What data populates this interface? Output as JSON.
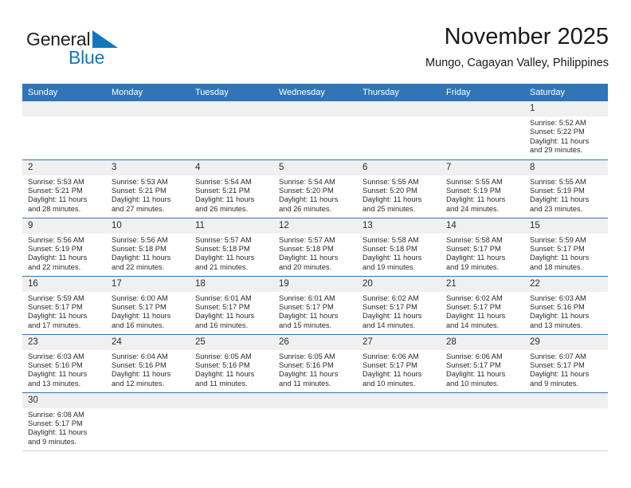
{
  "logo": {
    "word_one": "General",
    "word_two": "Blue",
    "flag_icon": "triangle-flag-icon",
    "blue": "#1278be"
  },
  "header": {
    "month_title": "November 2025",
    "location": "Mungo, Cagayan Valley, Philippines"
  },
  "colors": {
    "header_blue": "#3175b7",
    "daynum_gray": "#f0f0f0",
    "text": "#2b2b2b"
  },
  "weekday_headers": [
    "Sunday",
    "Monday",
    "Tuesday",
    "Wednesday",
    "Thursday",
    "Friday",
    "Saturday"
  ],
  "weeks": [
    [
      {
        "day": "",
        "sunrise": "",
        "sunset": "",
        "daylight_1": "",
        "daylight_2": ""
      },
      {
        "day": "",
        "sunrise": "",
        "sunset": "",
        "daylight_1": "",
        "daylight_2": ""
      },
      {
        "day": "",
        "sunrise": "",
        "sunset": "",
        "daylight_1": "",
        "daylight_2": ""
      },
      {
        "day": "",
        "sunrise": "",
        "sunset": "",
        "daylight_1": "",
        "daylight_2": ""
      },
      {
        "day": "",
        "sunrise": "",
        "sunset": "",
        "daylight_1": "",
        "daylight_2": ""
      },
      {
        "day": "",
        "sunrise": "",
        "sunset": "",
        "daylight_1": "",
        "daylight_2": ""
      },
      {
        "day": "1",
        "sunrise": "Sunrise: 5:52 AM",
        "sunset": "Sunset: 5:22 PM",
        "daylight_1": "Daylight: 11 hours",
        "daylight_2": "and 29 minutes."
      }
    ],
    [
      {
        "day": "2",
        "sunrise": "Sunrise: 5:53 AM",
        "sunset": "Sunset: 5:21 PM",
        "daylight_1": "Daylight: 11 hours",
        "daylight_2": "and 28 minutes."
      },
      {
        "day": "3",
        "sunrise": "Sunrise: 5:53 AM",
        "sunset": "Sunset: 5:21 PM",
        "daylight_1": "Daylight: 11 hours",
        "daylight_2": "and 27 minutes."
      },
      {
        "day": "4",
        "sunrise": "Sunrise: 5:54 AM",
        "sunset": "Sunset: 5:21 PM",
        "daylight_1": "Daylight: 11 hours",
        "daylight_2": "and 26 minutes."
      },
      {
        "day": "5",
        "sunrise": "Sunrise: 5:54 AM",
        "sunset": "Sunset: 5:20 PM",
        "daylight_1": "Daylight: 11 hours",
        "daylight_2": "and 26 minutes."
      },
      {
        "day": "6",
        "sunrise": "Sunrise: 5:55 AM",
        "sunset": "Sunset: 5:20 PM",
        "daylight_1": "Daylight: 11 hours",
        "daylight_2": "and 25 minutes."
      },
      {
        "day": "7",
        "sunrise": "Sunrise: 5:55 AM",
        "sunset": "Sunset: 5:19 PM",
        "daylight_1": "Daylight: 11 hours",
        "daylight_2": "and 24 minutes."
      },
      {
        "day": "8",
        "sunrise": "Sunrise: 5:55 AM",
        "sunset": "Sunset: 5:19 PM",
        "daylight_1": "Daylight: 11 hours",
        "daylight_2": "and 23 minutes."
      }
    ],
    [
      {
        "day": "9",
        "sunrise": "Sunrise: 5:56 AM",
        "sunset": "Sunset: 5:19 PM",
        "daylight_1": "Daylight: 11 hours",
        "daylight_2": "and 22 minutes."
      },
      {
        "day": "10",
        "sunrise": "Sunrise: 5:56 AM",
        "sunset": "Sunset: 5:18 PM",
        "daylight_1": "Daylight: 11 hours",
        "daylight_2": "and 22 minutes."
      },
      {
        "day": "11",
        "sunrise": "Sunrise: 5:57 AM",
        "sunset": "Sunset: 5:18 PM",
        "daylight_1": "Daylight: 11 hours",
        "daylight_2": "and 21 minutes."
      },
      {
        "day": "12",
        "sunrise": "Sunrise: 5:57 AM",
        "sunset": "Sunset: 5:18 PM",
        "daylight_1": "Daylight: 11 hours",
        "daylight_2": "and 20 minutes."
      },
      {
        "day": "13",
        "sunrise": "Sunrise: 5:58 AM",
        "sunset": "Sunset: 5:18 PM",
        "daylight_1": "Daylight: 11 hours",
        "daylight_2": "and 19 minutes."
      },
      {
        "day": "14",
        "sunrise": "Sunrise: 5:58 AM",
        "sunset": "Sunset: 5:17 PM",
        "daylight_1": "Daylight: 11 hours",
        "daylight_2": "and 19 minutes."
      },
      {
        "day": "15",
        "sunrise": "Sunrise: 5:59 AM",
        "sunset": "Sunset: 5:17 PM",
        "daylight_1": "Daylight: 11 hours",
        "daylight_2": "and 18 minutes."
      }
    ],
    [
      {
        "day": "16",
        "sunrise": "Sunrise: 5:59 AM",
        "sunset": "Sunset: 5:17 PM",
        "daylight_1": "Daylight: 11 hours",
        "daylight_2": "and 17 minutes."
      },
      {
        "day": "17",
        "sunrise": "Sunrise: 6:00 AM",
        "sunset": "Sunset: 5:17 PM",
        "daylight_1": "Daylight: 11 hours",
        "daylight_2": "and 16 minutes."
      },
      {
        "day": "18",
        "sunrise": "Sunrise: 6:01 AM",
        "sunset": "Sunset: 5:17 PM",
        "daylight_1": "Daylight: 11 hours",
        "daylight_2": "and 16 minutes."
      },
      {
        "day": "19",
        "sunrise": "Sunrise: 6:01 AM",
        "sunset": "Sunset: 5:17 PM",
        "daylight_1": "Daylight: 11 hours",
        "daylight_2": "and 15 minutes."
      },
      {
        "day": "20",
        "sunrise": "Sunrise: 6:02 AM",
        "sunset": "Sunset: 5:17 PM",
        "daylight_1": "Daylight: 11 hours",
        "daylight_2": "and 14 minutes."
      },
      {
        "day": "21",
        "sunrise": "Sunrise: 6:02 AM",
        "sunset": "Sunset: 5:17 PM",
        "daylight_1": "Daylight: 11 hours",
        "daylight_2": "and 14 minutes."
      },
      {
        "day": "22",
        "sunrise": "Sunrise: 6:03 AM",
        "sunset": "Sunset: 5:16 PM",
        "daylight_1": "Daylight: 11 hours",
        "daylight_2": "and 13 minutes."
      }
    ],
    [
      {
        "day": "23",
        "sunrise": "Sunrise: 6:03 AM",
        "sunset": "Sunset: 5:16 PM",
        "daylight_1": "Daylight: 11 hours",
        "daylight_2": "and 13 minutes."
      },
      {
        "day": "24",
        "sunrise": "Sunrise: 6:04 AM",
        "sunset": "Sunset: 5:16 PM",
        "daylight_1": "Daylight: 11 hours",
        "daylight_2": "and 12 minutes."
      },
      {
        "day": "25",
        "sunrise": "Sunrise: 6:05 AM",
        "sunset": "Sunset: 5:16 PM",
        "daylight_1": "Daylight: 11 hours",
        "daylight_2": "and 11 minutes."
      },
      {
        "day": "26",
        "sunrise": "Sunrise: 6:05 AM",
        "sunset": "Sunset: 5:16 PM",
        "daylight_1": "Daylight: 11 hours",
        "daylight_2": "and 11 minutes."
      },
      {
        "day": "27",
        "sunrise": "Sunrise: 6:06 AM",
        "sunset": "Sunset: 5:17 PM",
        "daylight_1": "Daylight: 11 hours",
        "daylight_2": "and 10 minutes."
      },
      {
        "day": "28",
        "sunrise": "Sunrise: 6:06 AM",
        "sunset": "Sunset: 5:17 PM",
        "daylight_1": "Daylight: 11 hours",
        "daylight_2": "and 10 minutes."
      },
      {
        "day": "29",
        "sunrise": "Sunrise: 6:07 AM",
        "sunset": "Sunset: 5:17 PM",
        "daylight_1": "Daylight: 11 hours",
        "daylight_2": "and 9 minutes."
      }
    ],
    [
      {
        "day": "30",
        "sunrise": "Sunrise: 6:08 AM",
        "sunset": "Sunset: 5:17 PM",
        "daylight_1": "Daylight: 11 hours",
        "daylight_2": "and 9 minutes."
      },
      {
        "day": "",
        "sunrise": "",
        "sunset": "",
        "daylight_1": "",
        "daylight_2": ""
      },
      {
        "day": "",
        "sunrise": "",
        "sunset": "",
        "daylight_1": "",
        "daylight_2": ""
      },
      {
        "day": "",
        "sunrise": "",
        "sunset": "",
        "daylight_1": "",
        "daylight_2": ""
      },
      {
        "day": "",
        "sunrise": "",
        "sunset": "",
        "daylight_1": "",
        "daylight_2": ""
      },
      {
        "day": "",
        "sunrise": "",
        "sunset": "",
        "daylight_1": "",
        "daylight_2": ""
      },
      {
        "day": "",
        "sunrise": "",
        "sunset": "",
        "daylight_1": "",
        "daylight_2": ""
      }
    ]
  ]
}
